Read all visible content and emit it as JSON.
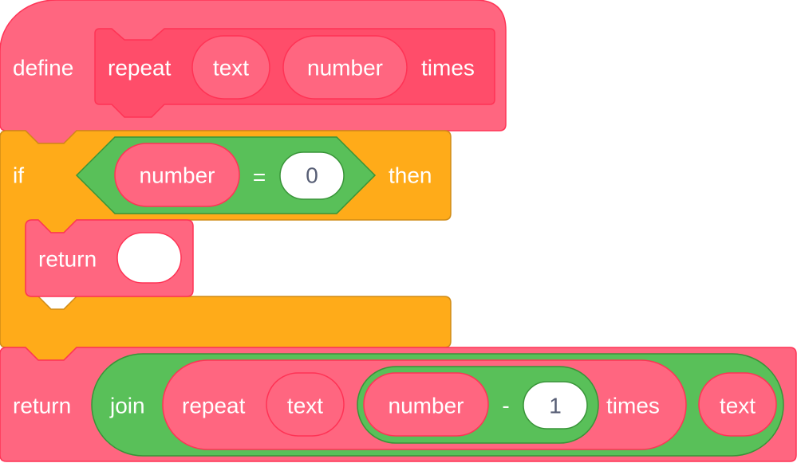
{
  "colors": {
    "custom_block": "#ff6680",
    "custom_block_dark": "#ff4d6a",
    "custom_border": "#ff3355",
    "control": "#ffab19",
    "control_border": "#cf8b17",
    "operator": "#59c059",
    "operator_border": "#389438",
    "input_text": "#575e75",
    "input_bg": "#ffffff"
  },
  "define_block": {
    "keyword": "define",
    "prototype": {
      "label": "repeat",
      "arg1": "text",
      "arg2": "number",
      "suffix": "times"
    }
  },
  "if_block": {
    "keyword": "if",
    "then_label": "then",
    "condition": {
      "left": "number",
      "operator": "=",
      "right": "0"
    },
    "body": {
      "return_label": "return",
      "return_value": ""
    }
  },
  "return_block": {
    "keyword": "return",
    "join": {
      "label": "join",
      "call": {
        "label": "repeat",
        "arg1": "text",
        "subtract": {
          "left": "number",
          "operator": "-",
          "right": "1"
        },
        "suffix": "times"
      },
      "arg2": "text"
    }
  }
}
